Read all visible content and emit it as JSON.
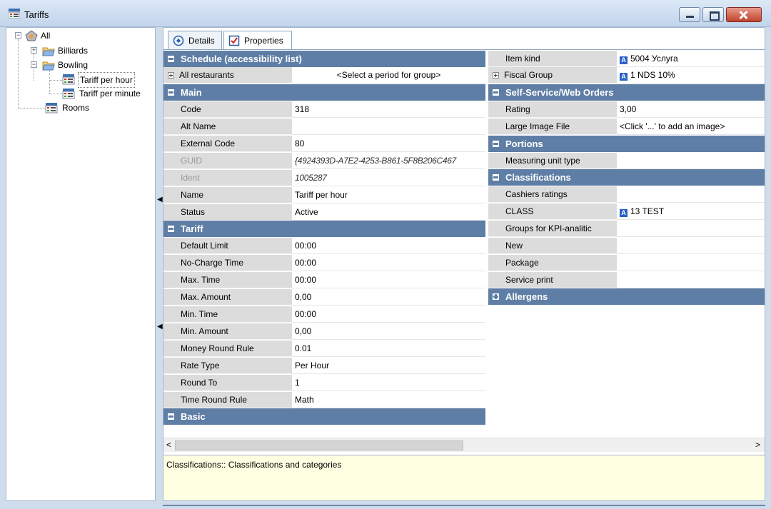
{
  "window": {
    "title": "Tariffs"
  },
  "tree": {
    "all": "All",
    "billiards": "Billiards",
    "bowling": "Bowling",
    "tariff_per_hour": "Tariff per hour",
    "tariff_per_minute": "Tariff per minute",
    "rooms": "Rooms"
  },
  "tabs": {
    "details": "Details",
    "properties": "Properties"
  },
  "left_grid": {
    "schedule": {
      "header": "Schedule (accessibility list)",
      "all_restaurants_label": "All restaurants",
      "all_restaurants_value": "<Select a period for group>"
    },
    "main": {
      "header": "Main",
      "code_label": "Code",
      "code_value": "318",
      "alt_name_label": "Alt Name",
      "alt_name_value": "",
      "external_code_label": "External Code",
      "external_code_value": "80",
      "guid_label": "GUID",
      "guid_value": "{4924393D-A7E2-4253-B861-5F8B206C467",
      "ident_label": "Ident",
      "ident_value": "1005287",
      "name_label": "Name",
      "name_value": "Tariff per hour",
      "status_label": "Status",
      "status_value": "Active"
    },
    "tariff": {
      "header": "Tariff",
      "default_limit_label": "Default Limit",
      "default_limit_value": "00:00",
      "no_charge_label": "No-Charge Time",
      "no_charge_value": "00:00",
      "max_time_label": "Max. Time",
      "max_time_value": "00:00",
      "max_amount_label": "Max. Amount",
      "max_amount_value": "0,00",
      "min_time_label": "Min. Time",
      "min_time_value": "00:00",
      "min_amount_label": "Min. Amount",
      "min_amount_value": "0,00",
      "money_round_label": "Money Round Rule",
      "money_round_value": "0.01",
      "rate_type_label": "Rate Type",
      "rate_type_value": "Per Hour",
      "round_to_label": "Round To",
      "round_to_value": "1",
      "time_round_label": "Time Round Rule",
      "time_round_value": "Math"
    },
    "basic": {
      "header": "Basic"
    }
  },
  "right_grid": {
    "item_kind_label": "Item kind",
    "item_kind_value": "5004 Услуга",
    "fiscal_group_label": "Fiscal Group",
    "fiscal_group_value": "1 NDS 10%",
    "self_service_header": "Self-Service/Web Orders",
    "rating_label": "Rating",
    "rating_value": "3,00",
    "large_image_label": "Large Image File",
    "large_image_value": "<Click '...' to add an image>",
    "portions_header": "Portions",
    "measuring_unit_label": "Measuring unit type",
    "measuring_unit_value": "",
    "classifications_header": "Classifications",
    "cashiers_ratings_label": "Cashiers ratings",
    "class_label": "CLASS",
    "class_value": "13 TEST",
    "groups_kpi_label": "Groups for KPI-analitic",
    "new_label": "New",
    "package_label": "Package",
    "service_print_label": "Service print",
    "allergens_header": "Allergens",
    "badge_letter": "A"
  },
  "description": "Classifications:: Classifications and categories",
  "colors": {
    "section_header": "#5f7ea6",
    "description_bg": "#ffffe1",
    "name_cell": "#dcdcdc"
  }
}
